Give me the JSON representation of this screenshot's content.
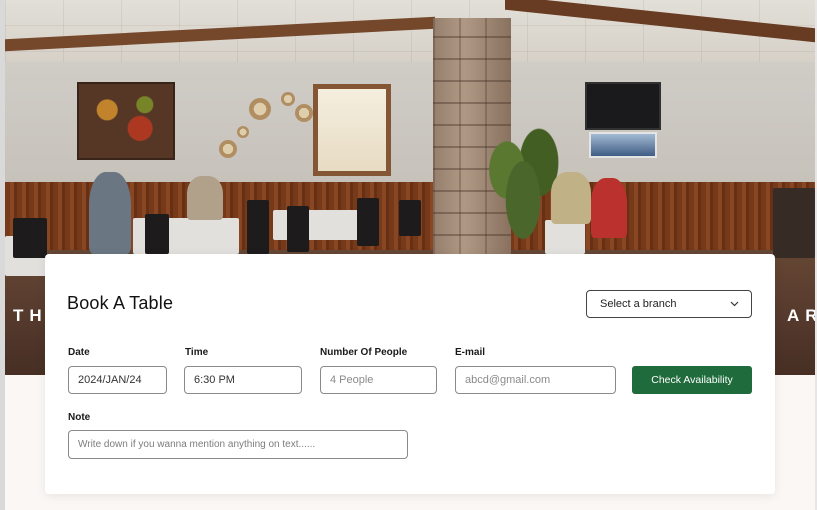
{
  "hero": {
    "overlay_left": "TH",
    "overlay_right": "AR"
  },
  "booking": {
    "title": "Book A Table",
    "branch_select": {
      "placeholder": "Select a branch"
    },
    "fields": {
      "date": {
        "label": "Date",
        "value": "2024/JAN/24"
      },
      "time": {
        "label": "Time",
        "value": "6:30 PM"
      },
      "people": {
        "label": "Number Of People",
        "placeholder": "4 People"
      },
      "email": {
        "label": "E-mail",
        "placeholder": "abcd@gmail.com"
      }
    },
    "check_button": "Check Availability",
    "note": {
      "label": "Note",
      "placeholder": "Write down if you wanna mention anything on text......"
    }
  },
  "colors": {
    "accent": "#1f6b3c",
    "page_background": "#fbf7f5"
  },
  "icons": {
    "branch_dropdown": "chevron-down-icon"
  }
}
